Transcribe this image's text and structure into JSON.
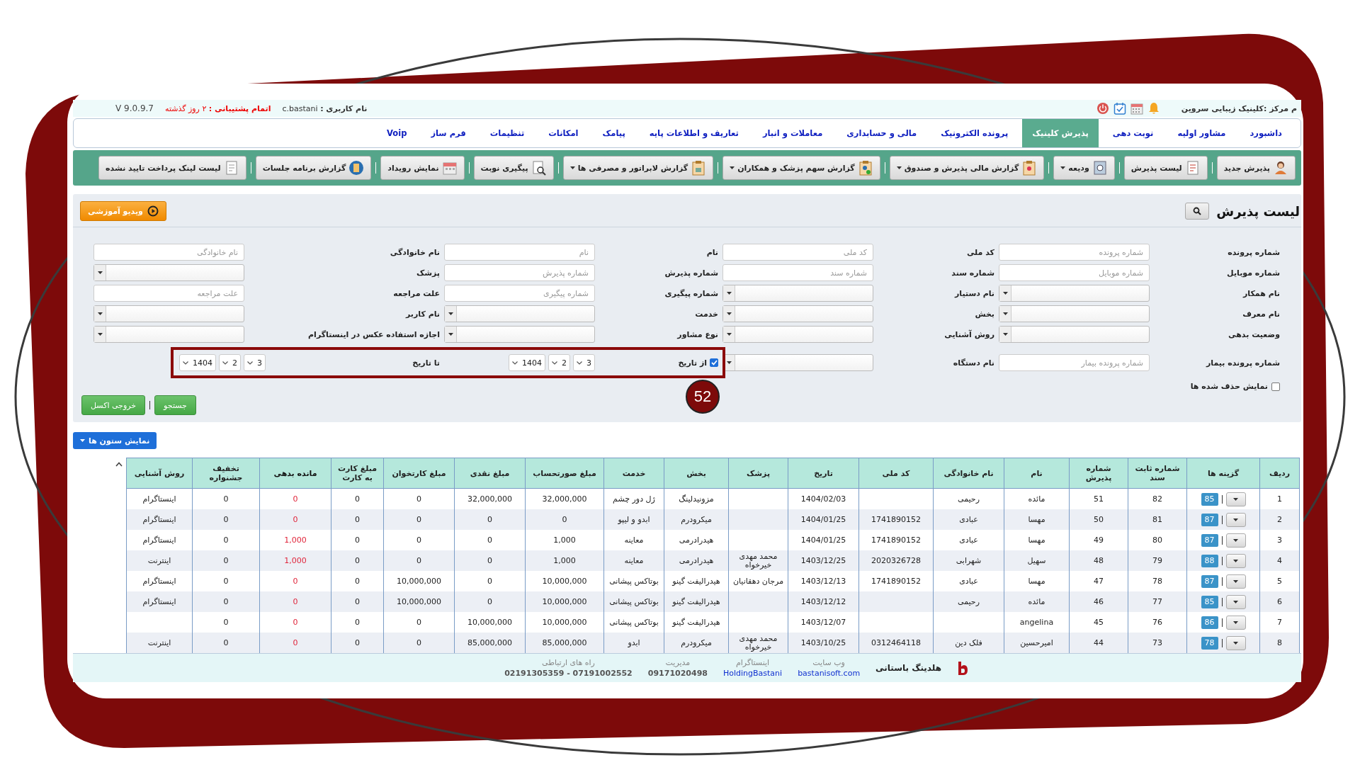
{
  "top_bar": {
    "center_name": "م مرکز :کلینیک زیبایی سروین",
    "user": "**نام کاربری :** c.bastani",
    "support": "**اتمام پشتیبانی :** ۲ روز گذشته",
    "version": "V 9.0.9.7"
  },
  "nav_tabs": [
    {
      "label": "داشبورد",
      "selected": false
    },
    {
      "label": "مشاور اولیه",
      "selected": false
    },
    {
      "label": "نوبت دهی",
      "selected": false
    },
    {
      "label": "پذیرش کلینیک",
      "selected": true
    },
    {
      "label": "پرونده الکترونیک",
      "selected": false
    },
    {
      "label": "مالی و حسابداری",
      "selected": false
    },
    {
      "label": "معاملات و انبار",
      "selected": false
    },
    {
      "label": "تعاریف و اطلاعات پایه",
      "selected": false
    },
    {
      "label": "پیامک",
      "selected": false
    },
    {
      "label": "امکانات",
      "selected": false
    },
    {
      "label": "تنظیمات",
      "selected": false
    },
    {
      "label": "فرم ساز",
      "selected": false
    },
    {
      "label": "Voip",
      "selected": false
    }
  ],
  "toolbar": [
    {
      "label": "پذیرش جدید",
      "dropdown": false
    },
    {
      "label": "لیست پذیرش",
      "dropdown": false
    },
    {
      "label": "ودیعه",
      "dropdown": true
    },
    {
      "label": "گزارش مالی پذیرش و صندوق",
      "dropdown": true
    },
    {
      "label": "گزارش سهم پزشک و همکاران",
      "dropdown": true
    },
    {
      "label": "گزارش لابراتور و مصرفی ها",
      "dropdown": true
    },
    {
      "label": "پیگیری نوبت",
      "dropdown": false
    },
    {
      "label": "نمایش رویداد",
      "dropdown": false
    },
    {
      "label": "گزارش برنامه جلسات",
      "dropdown": false
    },
    {
      "label": "لیست لینک پرداخت تایید نشده",
      "dropdown": false
    }
  ],
  "panel": {
    "title": "لیست پذیرش",
    "video_button": "ویدیو آموزشی"
  },
  "filters": {
    "callout": {
      "number": "52"
    },
    "rows": [
      [
        {
          "label": "شماره پرونده",
          "kind": "text",
          "placeholder": "شماره پرونده"
        },
        {
          "label": "کد ملی",
          "kind": "text",
          "placeholder": "کد ملی"
        },
        {
          "label": "نام",
          "kind": "text",
          "placeholder": "نام"
        },
        {
          "label": "نام خانوادگی",
          "kind": "text",
          "placeholder": "نام خانوادگی"
        }
      ],
      [
        {
          "label": "شماره موبایل",
          "kind": "text",
          "placeholder": "شماره موبایل"
        },
        {
          "label": "شماره سند",
          "kind": "text",
          "placeholder": "شماره سند"
        },
        {
          "label": "شماره پذیرش",
          "kind": "text",
          "placeholder": "شماره پذیرش"
        },
        {
          "label": "پزشک",
          "kind": "select"
        }
      ],
      [
        {
          "label": "نام همکار",
          "kind": "select"
        },
        {
          "label": "نام دستیار",
          "kind": "select"
        },
        {
          "label": "شماره پیگیری",
          "kind": "text",
          "placeholder": "شماره پیگیری"
        },
        {
          "label": "علت مراجعه",
          "kind": "text",
          "placeholder": "علت مراجعه"
        }
      ],
      [
        {
          "label": "نام معرف",
          "kind": "select"
        },
        {
          "label": "بخش",
          "kind": "select"
        },
        {
          "label": "خدمت",
          "kind": "select"
        },
        {
          "label": "نام کاربر",
          "kind": "select"
        }
      ],
      [
        {
          "label": "وضعیت بدهی",
          "kind": "select"
        },
        {
          "label": "روش آشنایی",
          "kind": "select"
        },
        {
          "label": "نوع مشاور",
          "kind": "select"
        },
        {
          "label": "اجازه استفاده عکس در اینستاگرام",
          "kind": "select"
        }
      ],
      [
        {
          "label": "شماره پرونده بیمار",
          "kind": "text",
          "placeholder": "شماره پرونده بیمار"
        },
        {
          "label": "نام دستگاه",
          "kind": "select"
        },
        {
          "label": "از تاریخ",
          "kind": "date",
          "checked": true,
          "highlighted": true,
          "values": [
            "3",
            "2",
            "1404"
          ]
        },
        {
          "label": "تا تاریخ",
          "kind": "date",
          "highlighted": true,
          "values": [
            "3",
            "2",
            "1404"
          ]
        }
      ]
    ]
  },
  "show_deleted": {
    "label": "نمایش حذف شده ها",
    "checked": false
  },
  "actions": [
    {
      "label": "جستجو"
    },
    {
      "label": "خروجی اکسل"
    }
  ],
  "columns_button": "نمایش ستون ها",
  "table": {
    "columns": [
      {
        "label": "ردیف",
        "emphasis": false
      },
      {
        "label": "گزینه ها",
        "emphasis": false
      },
      {
        "label": "شماره ثابت سند",
        "emphasis": false
      },
      {
        "label": "شماره پذیرش",
        "emphasis": false
      },
      {
        "label": "نام",
        "emphasis": false
      },
      {
        "label": "نام خانوادگی",
        "emphasis": false
      },
      {
        "label": "کد ملی",
        "emphasis": false
      },
      {
        "label": "تاریخ",
        "emphasis": false
      },
      {
        "label": "پزشک",
        "emphasis": false
      },
      {
        "label": "بخش",
        "emphasis": false
      },
      {
        "label": "خدمت",
        "emphasis": false
      },
      {
        "label": "مبلغ صورتحساب",
        "emphasis": false
      },
      {
        "label": "مبلغ نقدی",
        "emphasis": false
      },
      {
        "label": "مبلغ کارتخوان",
        "emphasis": false
      },
      {
        "label": "مبلغ کارت به کارت",
        "emphasis": false
      },
      {
        "label": "مانده بدهی",
        "emphasis": true
      },
      {
        "label": "تخفیف جشنواره",
        "emphasis": false
      },
      {
        "label": "روش آشنایی",
        "emphasis": false
      }
    ],
    "rows": [
      [
        "1",
        "85",
        "82",
        "51",
        "مائده",
        "رحیمی",
        "",
        "1404/02/03",
        "",
        "مزونیدلینگ",
        "ژل دور چشم",
        "32,000,000",
        "32,000,000",
        "0",
        "0",
        "0",
        "0",
        "اینستاگرام"
      ],
      [
        "2",
        "87",
        "81",
        "50",
        "مهسا",
        "عبادی",
        "1741890152",
        "1404/01/25",
        "",
        "میکرودرم",
        "ابدو و لیپو",
        "0",
        "0",
        "0",
        "0",
        "0",
        "0",
        "اینستاگرام"
      ],
      [
        "3",
        "87",
        "80",
        "49",
        "مهسا",
        "عبادی",
        "1741890152",
        "1404/01/25",
        "",
        "هیدرادرمی",
        "معاینه",
        "1,000",
        "0",
        "0",
        "0",
        "1,000",
        "0",
        "اینستاگرام"
      ],
      [
        "4",
        "88",
        "79",
        "48",
        "سهیل",
        "شهرابی",
        "2020326728",
        "1403/12/25",
        "محمد مهدی خیرخواه",
        "هیدرادرمی",
        "معاینه",
        "1,000",
        "0",
        "0",
        "0",
        "1,000",
        "0",
        "اینترنت"
      ],
      [
        "5",
        "87",
        "78",
        "47",
        "مهسا",
        "عبادی",
        "1741890152",
        "1403/12/13",
        "مرجان دهقانیان",
        "هیدرالیفت گینو",
        "بوتاکس پیشانی",
        "10,000,000",
        "0",
        "10,000,000",
        "0",
        "0",
        "0",
        "اینستاگرام"
      ],
      [
        "6",
        "85",
        "77",
        "46",
        "مائده",
        "رحیمی",
        "",
        "1403/12/12",
        "",
        "هیدرالیفت گینو",
        "بوتاکس پیشانی",
        "10,000,000",
        "0",
        "10,000,000",
        "0",
        "0",
        "0",
        "اینستاگرام"
      ],
      [
        "7",
        "86",
        "76",
        "45",
        "angelina",
        "",
        "",
        "1403/12/07",
        "",
        "هیدرالیفت گینو",
        "بوتاکس پیشانی",
        "10,000,000",
        "10,000,000",
        "0",
        "0",
        "0",
        "0",
        ""
      ],
      [
        "8",
        "78",
        "73",
        "44",
        "امیرحسین",
        "فلک دین",
        "0312464118",
        "1403/10/25",
        "محمد مهدی خیرخواه",
        "میکرودرم",
        "ابدو",
        "85,000,000",
        "85,000,000",
        "0",
        "0",
        "0",
        "0",
        "اینترنت"
      ]
    ]
  },
  "footer": {
    "company": "هلدینگ باستانی",
    "contacts": [
      {
        "label": "وب سایت",
        "value": "bastanisoft.com",
        "kind": "link"
      },
      {
        "label": "اینستاگرام",
        "value": "HoldingBastani",
        "kind": "link"
      },
      {
        "label": "مدیریت",
        "value": "09171020498",
        "kind": "phone"
      },
      {
        "label": "راه های ارتباطی",
        "value": "07191002552 - 02191305359",
        "kind": "phone"
      }
    ]
  }
}
